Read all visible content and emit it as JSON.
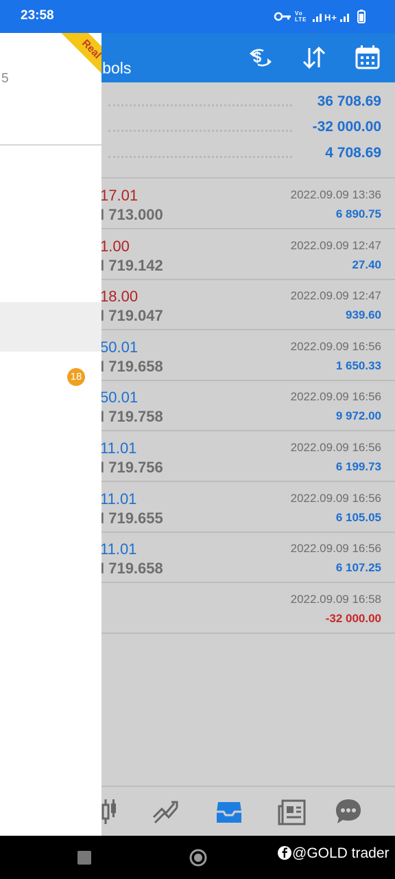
{
  "status_bar": {
    "time": "23:58",
    "indicators": "Vo LTE  H+"
  },
  "app_bar": {
    "title": "mbols"
  },
  "summary": [
    {
      "value": "36 708.69"
    },
    {
      "value": "-32 000.00"
    },
    {
      "value": "4 708.69"
    }
  ],
  "trades": [
    {
      "price1": "17.01",
      "price1_color": "#b22222",
      "price2": "I 713.000",
      "date": "2022.09.09 13:36",
      "profit": "6 890.75",
      "profit_color": "#1e6fd0"
    },
    {
      "price1": "1.00",
      "price1_color": "#b22222",
      "price2": "I 719.142",
      "date": "2022.09.09 12:47",
      "profit": "27.40",
      "profit_color": "#1e6fd0"
    },
    {
      "price1": "18.00",
      "price1_color": "#b22222",
      "price2": "I 719.047",
      "date": "2022.09.09 12:47",
      "profit": "939.60",
      "profit_color": "#1e6fd0"
    },
    {
      "price1": "50.01",
      "price1_color": "#1e6fd0",
      "price2": "I 719.658",
      "date": "2022.09.09 16:56",
      "profit": "1 650.33",
      "profit_color": "#1e6fd0"
    },
    {
      "price1": "50.01",
      "price1_color": "#1e6fd0",
      "price2": "I 719.758",
      "date": "2022.09.09 16:56",
      "profit": "9 972.00",
      "profit_color": "#1e6fd0"
    },
    {
      "price1": "11.01",
      "price1_color": "#1e6fd0",
      "price2": "I 719.756",
      "date": "2022.09.09 16:56",
      "profit": "6 199.73",
      "profit_color": "#1e6fd0"
    },
    {
      "price1": "11.01",
      "price1_color": "#1e6fd0",
      "price2": "I 719.655",
      "date": "2022.09.09 16:56",
      "profit": "6 105.05",
      "profit_color": "#1e6fd0"
    },
    {
      "price1": "11.01",
      "price1_color": "#1e6fd0",
      "price2": "I 719.658",
      "date": "2022.09.09 16:56",
      "profit": "6 107.25",
      "profit_color": "#1e6fd0"
    },
    {
      "price1": "",
      "price1_color": "#1e6fd0",
      "price2": "",
      "date": "2022.09.09 16:58",
      "profit": "-32 000.00",
      "profit_color": "#c62828"
    }
  ],
  "drawer": {
    "account_fragment": "5",
    "ribbon_label": "Real",
    "badge_count": "18"
  },
  "watermark": "@GOLD trader",
  "colors": {
    "accent": "#1e7ee0",
    "positive": "#1e6fd0",
    "negative": "#c62828"
  }
}
